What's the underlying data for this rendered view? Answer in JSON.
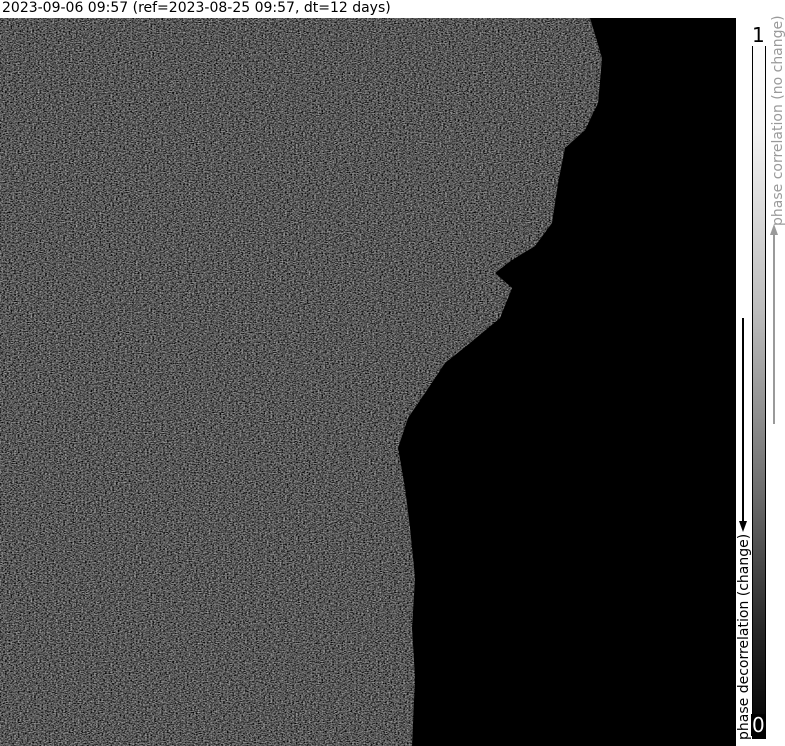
{
  "title": "2023-09-06 09:57 (ref=2023-08-25 09:57, dt=12 days)",
  "colorbar": {
    "max_label": "1",
    "min_label": "0",
    "low_label": "phase decorrelation (change)",
    "high_label": "phase correlation (no change)"
  },
  "colors": {
    "background": "#000000",
    "high_correlation": "#ffffff",
    "low_correlation": "#000000",
    "secondary_label": "#9a9a9a"
  },
  "icons": {
    "down_arrow": "arrow-down-icon",
    "up_arrow": "arrow-up-icon"
  }
}
